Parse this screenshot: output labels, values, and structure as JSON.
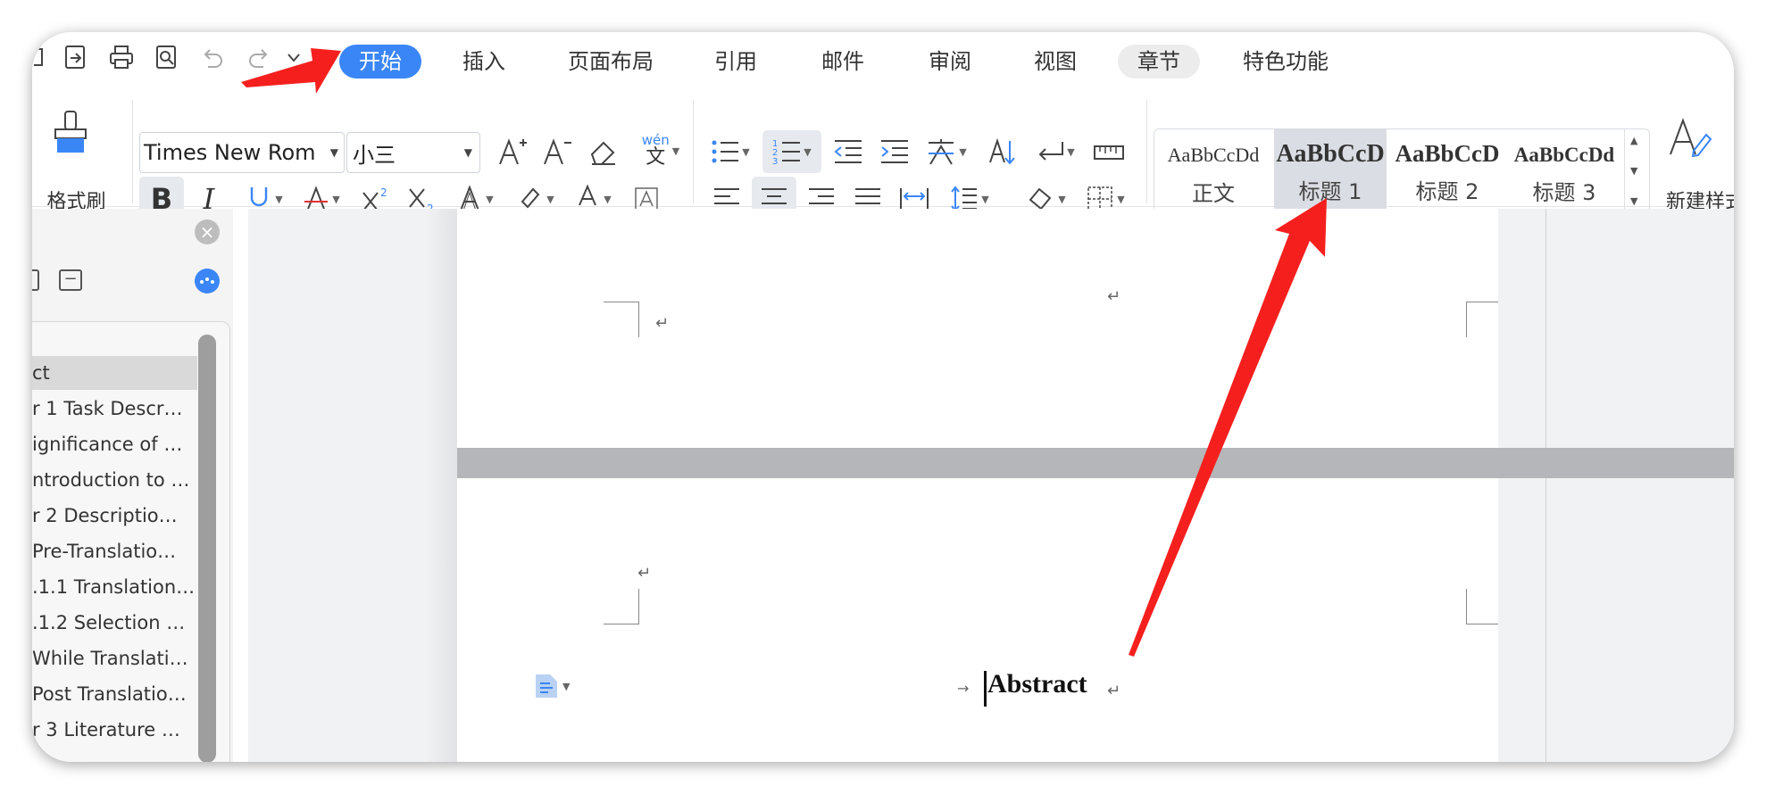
{
  "tabs": [
    {
      "label": "开始",
      "active": true
    },
    {
      "label": "插入"
    },
    {
      "label": "页面布局"
    },
    {
      "label": "引用"
    },
    {
      "label": "邮件"
    },
    {
      "label": "审阅"
    },
    {
      "label": "视图"
    },
    {
      "label": "章节"
    },
    {
      "label": "特色功能"
    }
  ],
  "ribbon": {
    "format_painter_label": "格式刷",
    "font_name": "Times New Rom",
    "font_size": "小三",
    "phonetic_label": "wén",
    "new_style_label": "新建样式"
  },
  "styles": [
    {
      "preview": "AaBbCcDd",
      "label": "正文"
    },
    {
      "preview": "AaBbCcD",
      "label": "标题 1"
    },
    {
      "preview": "AaBbCcD",
      "label": "标题 2"
    },
    {
      "preview": "AaBbCcDd",
      "label": "标题 3"
    }
  ],
  "outline": {
    "items": [
      "ct",
      "r 1 Task Descr…",
      "ignificance of …",
      "ntroduction to …",
      "r 2 Descriptio…",
      "Pre-Translatio…",
      ".1.1 Translation…",
      ".1.2 Selection …",
      "While Translati…",
      "Post Translatio…",
      "r 3 Literature …"
    ]
  },
  "document": {
    "heading": "Abstract",
    "paragraph_mark": "↵"
  },
  "colors": {
    "accent": "#3a86f7",
    "annotation_arrow": "#f5201e"
  }
}
